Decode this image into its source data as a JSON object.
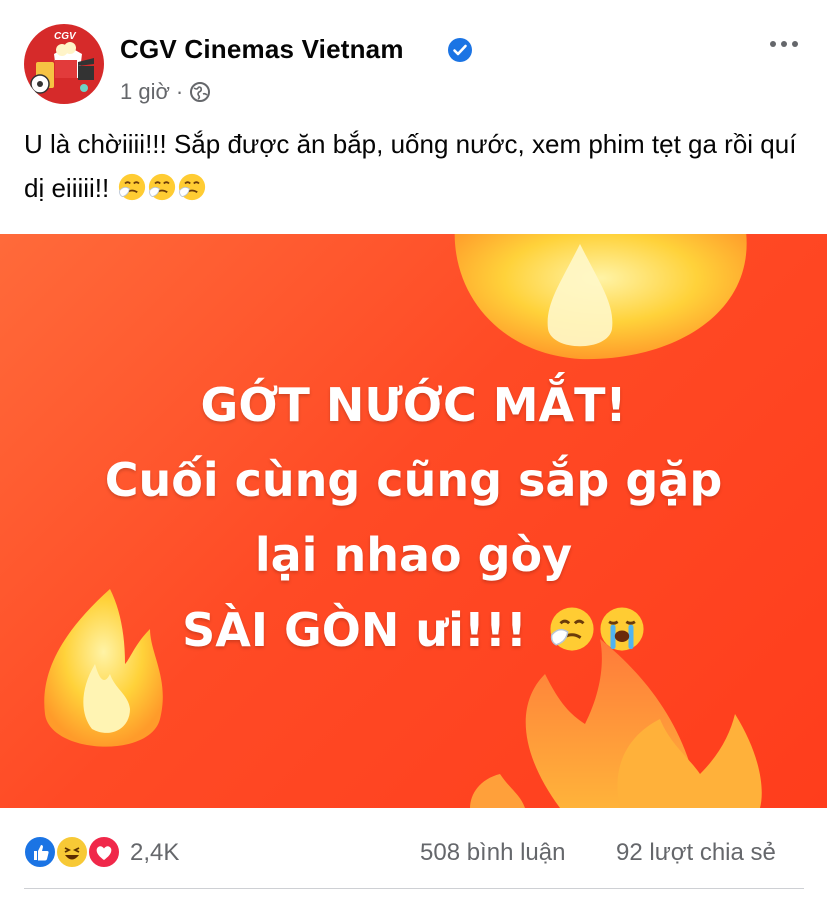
{
  "post": {
    "author": "CGV Cinemas Vietnam",
    "avatar_text": "CGV",
    "time": "1 giờ",
    "separator": "·",
    "caption": "U là chờiiii!!! Sắp được ăn bắp, uống nước, xem phim tẹt ga rồi quí dị eiiiii!!",
    "image_lines": [
      "GỚT NƯỚC MẮT!",
      "Cuối cùng cũng sắp gặp",
      "lại nhao gòy",
      "SÀI GÒN ưi!!!"
    ]
  },
  "reactions": {
    "count": "2,4K",
    "comments": "508 bình luận",
    "shares": "92 lượt chia sẻ"
  },
  "icons": {
    "verified": "verified-badge-icon",
    "audience": "globe-icon",
    "more": "more-options-icon",
    "caption_emoji": "sneezing-face-emoji",
    "image_emoji_1": "sneezing-face-emoji",
    "image_emoji_2": "loudly-crying-face-emoji",
    "reaction_1": "like-icon",
    "reaction_2": "haha-icon",
    "reaction_3": "love-icon"
  },
  "colors": {
    "brand_red": "#d62a2a",
    "verified_blue": "#1b74e4",
    "image_background": "#ff4a25",
    "flame_yellow": "#ffd23a",
    "secondary_text": "#65676b"
  }
}
